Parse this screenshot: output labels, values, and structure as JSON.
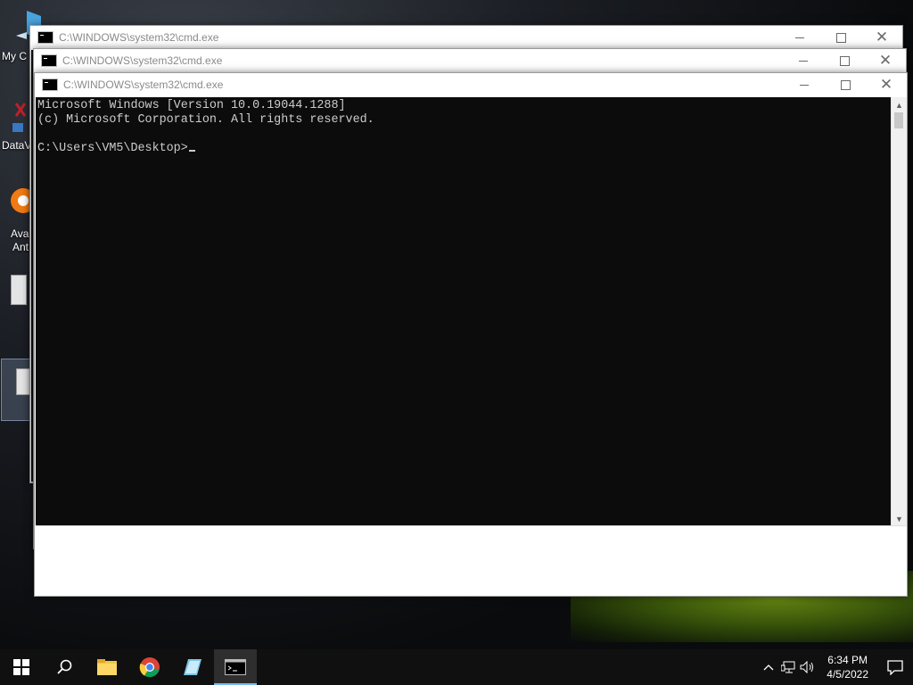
{
  "desktop": {
    "icons": [
      {
        "label": "My C"
      },
      {
        "label": "DataV"
      },
      {
        "label": "Ava"
      },
      {
        "label": "Ant"
      }
    ]
  },
  "windows": [
    {
      "title": "C:\\WINDOWS\\system32\\cmd.exe"
    },
    {
      "title": "C:\\WINDOWS\\system32\\cmd.exe"
    },
    {
      "title": "C:\\WINDOWS\\system32\\cmd.exe"
    }
  ],
  "console": {
    "lines": [
      "Microsoft Windows [Version 10.0.19044.1288]",
      "(c) Microsoft Corporation. All rights reserved.",
      "",
      "C:\\Users\\VM5\\Desktop>"
    ]
  },
  "taskbar": {
    "buttons": [
      "start-icon",
      "search-icon",
      "file-explorer-icon",
      "chrome-icon",
      "notepad-icon",
      "cmd-icon"
    ],
    "clock": {
      "time": "6:34 PM",
      "date": "4/5/2022"
    }
  },
  "colors": {
    "console_bg": "#0c0c0c",
    "console_text": "#cccccc",
    "taskbar_bg": "#101010",
    "active_accent": "#76b9ed"
  }
}
